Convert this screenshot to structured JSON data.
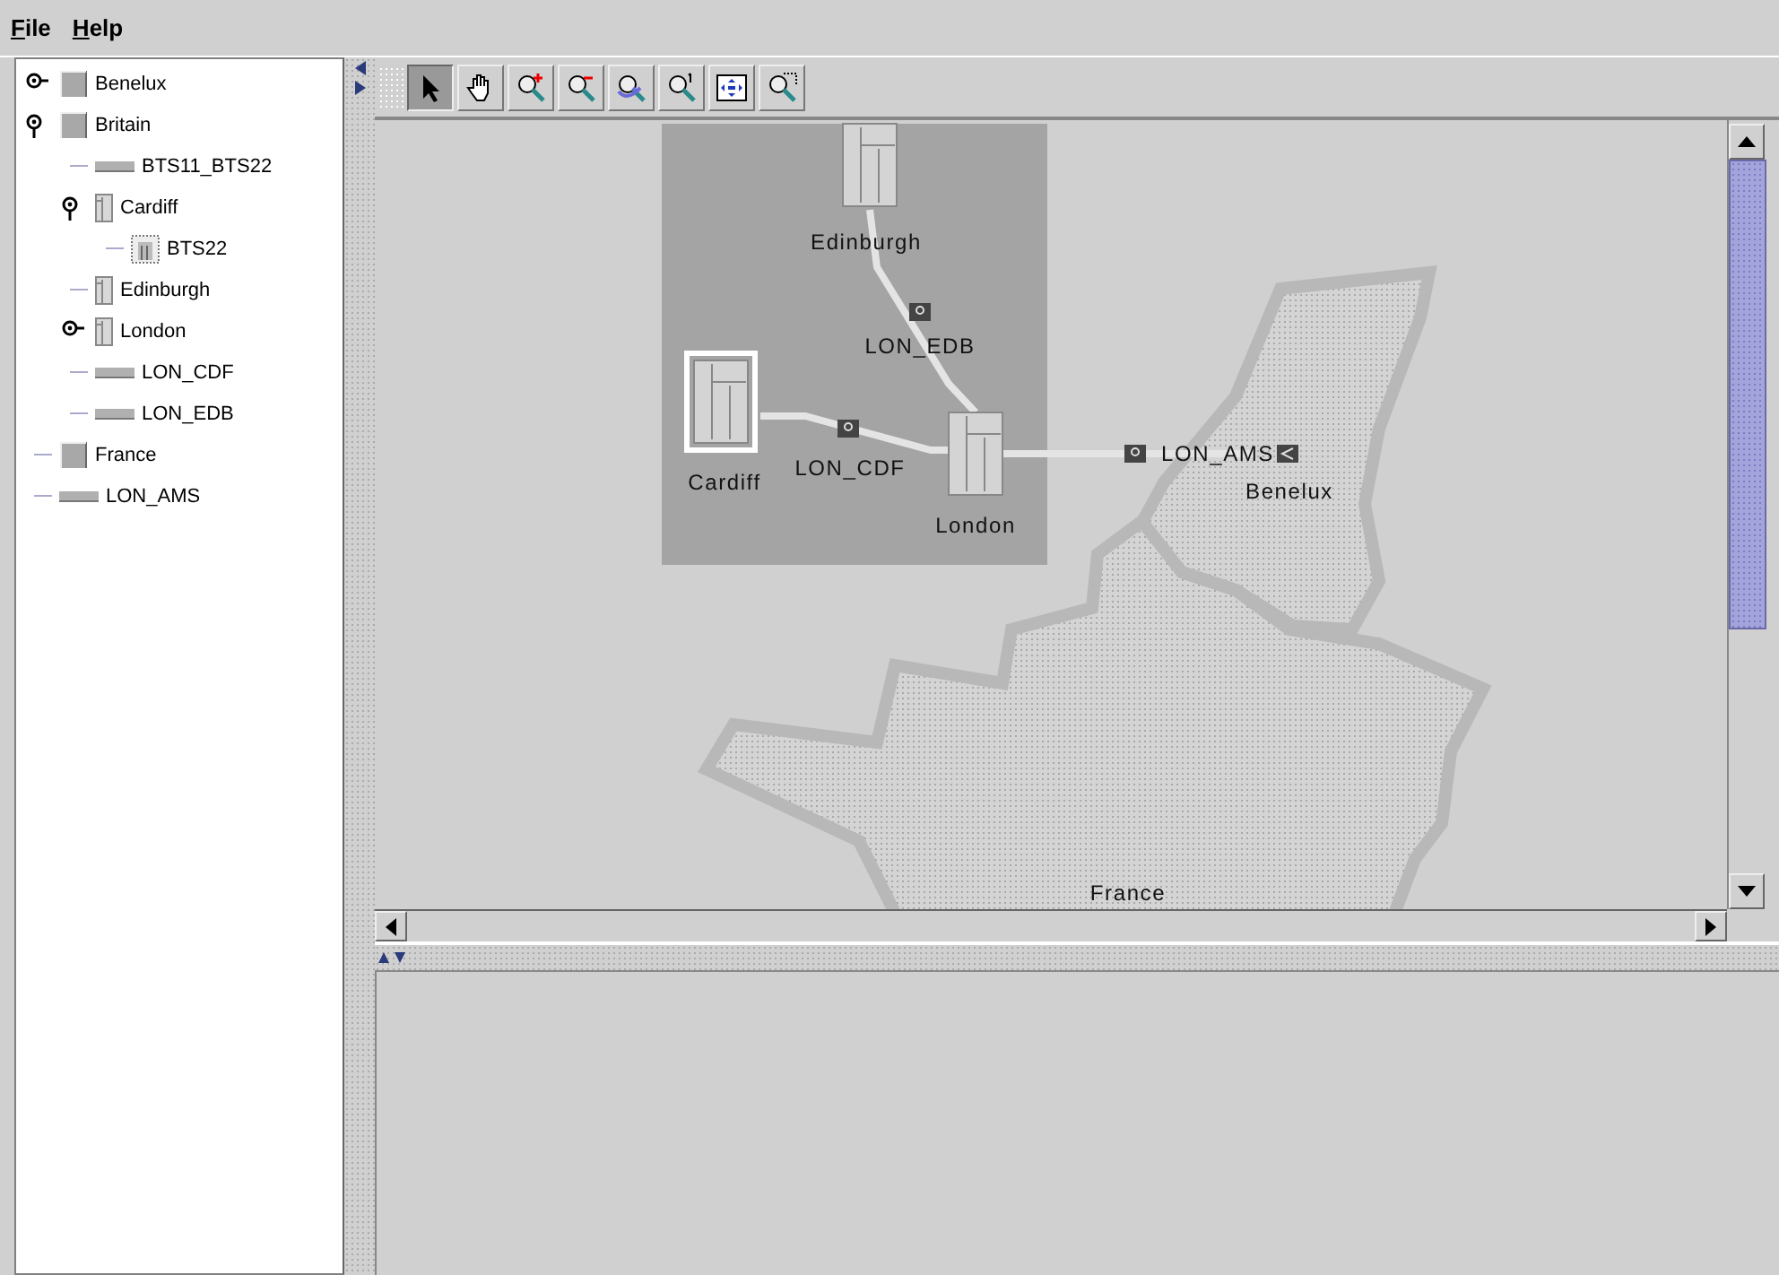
{
  "menu": [
    {
      "label": "File"
    },
    {
      "label": "Help"
    }
  ],
  "tree": [
    {
      "label": "Benelux",
      "kind": "region",
      "expanded": false
    },
    {
      "label": "Britain",
      "kind": "region",
      "expanded": true,
      "children": [
        {
          "label": "BTS11_BTS22",
          "kind": "link"
        },
        {
          "label": "Cardiff",
          "kind": "site",
          "expanded": true,
          "children": [
            {
              "label": "BTS22",
              "kind": "bts"
            }
          ]
        },
        {
          "label": "Edinburgh",
          "kind": "site"
        },
        {
          "label": "London",
          "kind": "site",
          "expanded": false
        },
        {
          "label": "LON_CDF",
          "kind": "link"
        },
        {
          "label": "LON_EDB",
          "kind": "link"
        }
      ]
    },
    {
      "label": "France",
      "kind": "region"
    },
    {
      "label": "LON_AMS",
      "kind": "link"
    }
  ],
  "tools": [
    {
      "kind": "select",
      "selected": true
    },
    {
      "kind": "pan",
      "selected": false
    },
    {
      "kind": "zoom-in",
      "selected": false
    },
    {
      "kind": "zoom-out",
      "selected": false
    },
    {
      "kind": "zoom-undo",
      "selected": false
    },
    {
      "kind": "zoom-one",
      "selected": false
    },
    {
      "kind": "fit",
      "selected": false
    },
    {
      "kind": "zoom-box",
      "selected": false
    }
  ],
  "map": {
    "regions": [
      {
        "label": "Benelux"
      },
      {
        "label": "France"
      }
    ],
    "sites": [
      {
        "label": "Edinburgh",
        "selected": false
      },
      {
        "label": "Cardiff",
        "selected": true
      },
      {
        "label": "London",
        "selected": false
      }
    ],
    "links": [
      {
        "label": "LON_EDB"
      },
      {
        "label": "LON_CDF"
      },
      {
        "label": "LON_AMS"
      }
    ]
  }
}
